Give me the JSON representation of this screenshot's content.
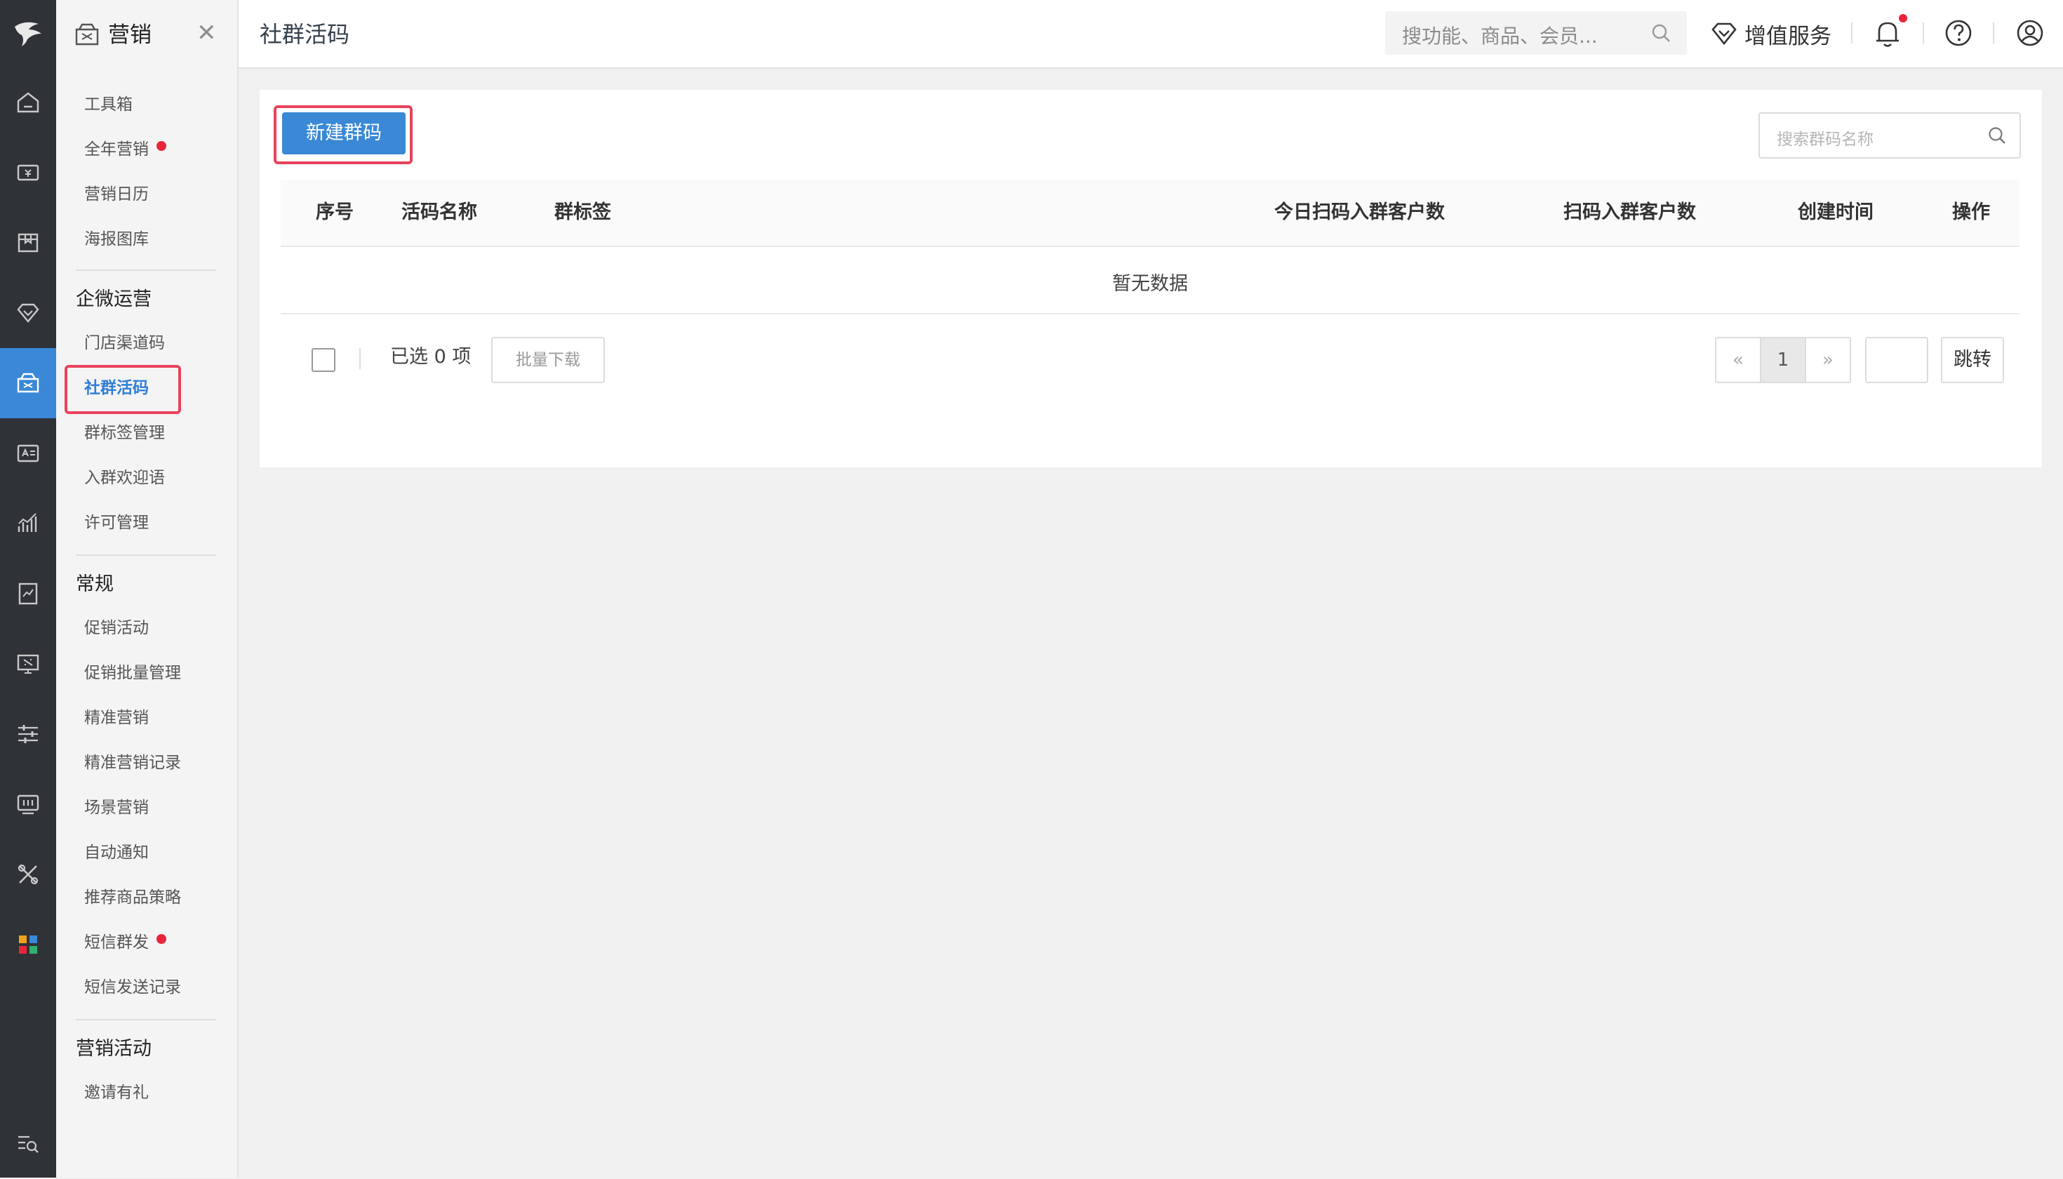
{
  "header": {
    "page_title": "社群活码",
    "search_placeholder": "搜功能、商品、会员...",
    "value_added_label": "增值服务"
  },
  "subnav": {
    "module_title": "营销",
    "items_top": [
      {
        "label": "工具箱"
      },
      {
        "label": "全年营销"
      },
      {
        "label": "营销日历"
      },
      {
        "label": "海报图库"
      }
    ],
    "section_wecom": "企微运营",
    "items_wecom": [
      {
        "label": "门店渠道码"
      },
      {
        "label": "社群活码"
      },
      {
        "label": "群标签管理"
      },
      {
        "label": "入群欢迎语"
      },
      {
        "label": "许可管理"
      }
    ],
    "section_regular": "常规",
    "items_regular": [
      {
        "label": "促销活动"
      },
      {
        "label": "促销批量管理"
      },
      {
        "label": "精准营销"
      },
      {
        "label": "精准营销记录"
      },
      {
        "label": "场景营销"
      },
      {
        "label": "自动通知"
      },
      {
        "label": "推荐商品策略"
      },
      {
        "label": "短信群发"
      },
      {
        "label": "短信发送记录"
      }
    ],
    "section_activity": "营销活动",
    "items_activity": [
      {
        "label": "邀请有礼"
      }
    ]
  },
  "toolbar": {
    "new_button": "新建群码",
    "search_placeholder": "搜索群码名称"
  },
  "table": {
    "columns": [
      "序号",
      "活码名称",
      "群标签",
      "今日扫码入群客户数",
      "扫码入群客户数",
      "创建时间",
      "操作"
    ],
    "empty_text": "暂无数据"
  },
  "footer": {
    "selected_text": "已选 0 项",
    "batch_download": "批量下载",
    "pager_prev": "«",
    "pager_current": "1",
    "pager_next": "»",
    "jump_label": "跳转"
  },
  "colors": {
    "accent": "#3a88d6",
    "rail_bg": "#2f3237",
    "highlight": "#e8435c",
    "badge": "#e8253b"
  }
}
